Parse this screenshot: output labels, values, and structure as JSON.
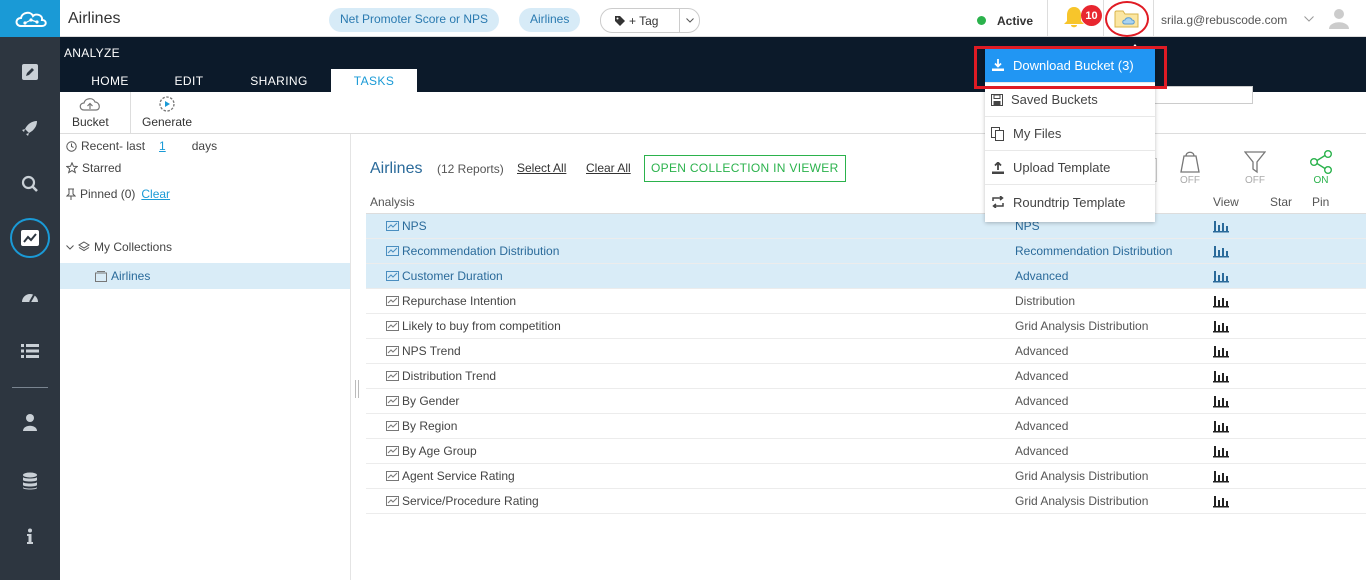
{
  "rail": {
    "items": [
      {
        "icon": "edit-icon"
      },
      {
        "icon": "rocket-icon"
      },
      {
        "icon": "search-icon"
      },
      {
        "icon": "analyze-chart-icon",
        "active": true
      },
      {
        "icon": "dashboard-icon"
      },
      {
        "icon": "list-icon"
      },
      {
        "icon": "user-icon"
      },
      {
        "icon": "database-icon"
      },
      {
        "icon": "info-icon"
      }
    ]
  },
  "header": {
    "title": "Airlines",
    "pills": [
      "Net Promoter Score or NPS",
      "Airlines"
    ],
    "tag_label": "+ Tag",
    "status": "Active",
    "notification_count": "10",
    "user_email": "srila.g@rebuscode.com"
  },
  "analyze": {
    "section_label": "ANALYZE",
    "tabs": [
      {
        "label": "HOME"
      },
      {
        "label": "EDIT"
      },
      {
        "label": "SHARING"
      },
      {
        "label": "TASKS",
        "active": true
      }
    ]
  },
  "toolbar": {
    "bucket_label": "Bucket",
    "generate_label": "Generate"
  },
  "left_panel": {
    "recent_label": "Recent- last",
    "recent_days": "1",
    "days_label": "days",
    "starred_label": "Starred",
    "pinned_label": "Pinned (0)",
    "clear_label": "Clear",
    "my_collections_label": "My Collections",
    "collection_item": "Airlines"
  },
  "main": {
    "collection_title": "Airlines",
    "report_count": "(12 Reports)",
    "select_all": "Select All",
    "clear_all": "Clear All",
    "open_viewer": "OPEN COLLECTION IN VIEWER",
    "controls": [
      {
        "icon": "bucket-filter-icon",
        "state": "OFF"
      },
      {
        "icon": "funnel-filter-icon",
        "state": "OFF"
      },
      {
        "icon": "share-icon",
        "state": "ON"
      }
    ],
    "columns": {
      "analysis": "Analysis",
      "view": "View",
      "star": "Star",
      "pin": "Pin"
    },
    "rows": [
      {
        "name": "NPS",
        "type": "NPS",
        "selected": true
      },
      {
        "name": "Recommendation Distribution",
        "type": "Recommendation Distribution",
        "selected": true
      },
      {
        "name": "Customer Duration",
        "type": "Advanced",
        "selected": true
      },
      {
        "name": "Repurchase Intention",
        "type": "Distribution",
        "selected": false
      },
      {
        "name": "Likely to buy from competition",
        "type": "Grid Analysis Distribution",
        "selected": false
      },
      {
        "name": "NPS Trend",
        "type": "Advanced",
        "selected": false
      },
      {
        "name": "Distribution Trend",
        "type": "Advanced",
        "selected": false
      },
      {
        "name": "By Gender",
        "type": "Advanced",
        "selected": false
      },
      {
        "name": "By Region",
        "type": "Advanced",
        "selected": false
      },
      {
        "name": "By Age Group",
        "type": "Advanced",
        "selected": false
      },
      {
        "name": "Agent Service Rating",
        "type": "Grid Analysis Distribution",
        "selected": false
      },
      {
        "name": "Service/Procedure Rating",
        "type": "Grid Analysis Distribution",
        "selected": false
      }
    ]
  },
  "bucket_menu": {
    "items": [
      {
        "label": "Download Bucket (3)",
        "icon": "download-icon",
        "highlighted": true
      },
      {
        "label": "Saved Buckets",
        "icon": "save-icon"
      },
      {
        "label": "My Files",
        "icon": "files-icon"
      },
      {
        "label": "Upload Template",
        "icon": "upload-icon"
      },
      {
        "label": "Roundtrip Template",
        "icon": "roundtrip-icon"
      }
    ]
  },
  "colors": {
    "rail_bg": "#2d3640",
    "accent": "#1a9ad6",
    "dark_bar": "#0c1a2a",
    "selection": "#d9ecf7",
    "menu_highlight": "#2196f3",
    "callout_red": "#e01b24",
    "green": "#2bb24c"
  }
}
